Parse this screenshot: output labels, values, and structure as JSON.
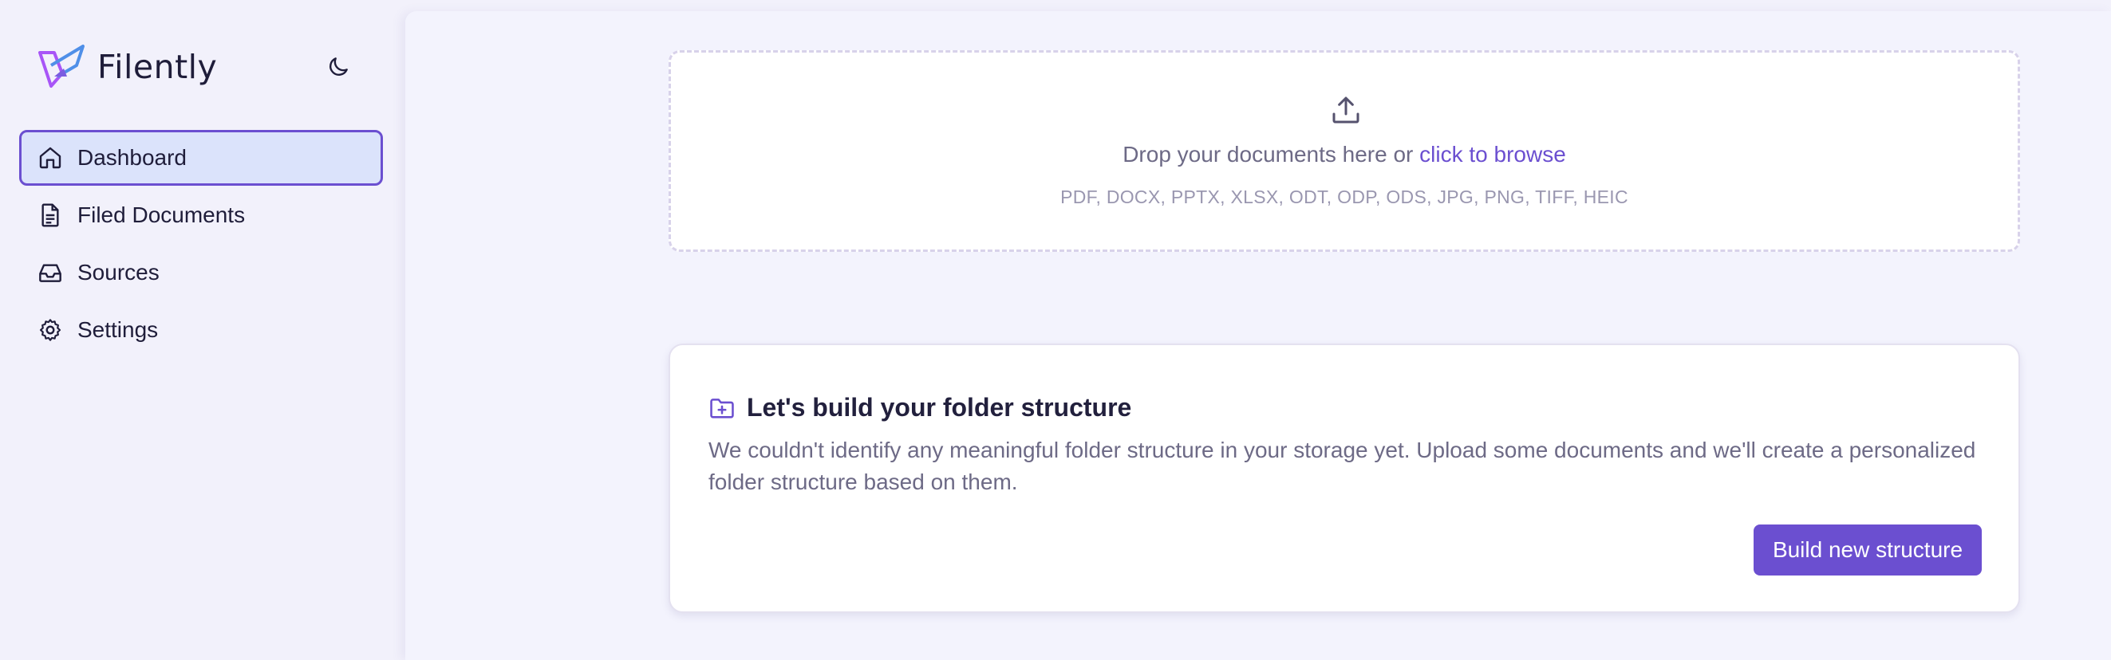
{
  "app": {
    "name": "Filently",
    "logo_icon": "filently-logo",
    "theme_toggle_icon": "moon-icon"
  },
  "sidebar": {
    "items": [
      {
        "label": "Dashboard",
        "icon": "home-icon",
        "active": true
      },
      {
        "label": "Filed Documents",
        "icon": "document-icon",
        "active": false
      },
      {
        "label": "Sources",
        "icon": "inbox-icon",
        "active": false
      },
      {
        "label": "Settings",
        "icon": "gear-icon",
        "active": false
      }
    ]
  },
  "upload": {
    "icon": "upload-icon",
    "prompt": "Drop your documents here or",
    "browse_link": "click to browse",
    "formats": "PDF, DOCX, PPTX, XLSX, ODT, ODP, ODS, JPG, PNG, TIFF, HEIC"
  },
  "folder_card": {
    "icon": "folder-plus-icon",
    "title": "Let's build your folder structure",
    "body": "We couldn't identify any meaningful folder structure in your storage yet. Upload some documents and we'll create a personalized folder structure based on them.",
    "button_label": "Build new structure"
  },
  "colors": {
    "accent": "#6b4fd0",
    "active_nav_bg": "#dbe3fb",
    "background": "#f2f1fb"
  }
}
